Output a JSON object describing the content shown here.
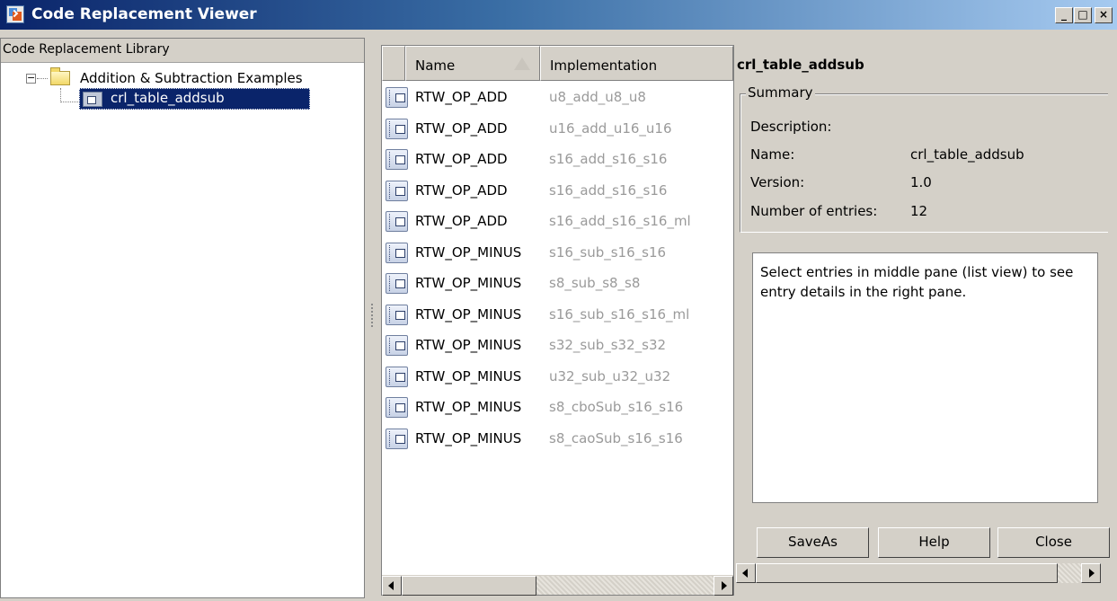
{
  "window": {
    "title": "Code Replacement Viewer",
    "icon": "code-replacement-app-icon"
  },
  "window_controls": {
    "minimize": "_",
    "maximize": "□",
    "close": "×"
  },
  "tree": {
    "header": "Code Replacement Library",
    "folder": {
      "label": "Addition & Subtraction Examples",
      "icon": "folder-icon",
      "expanded": true
    },
    "selected_item": {
      "label": "crl_table_addsub",
      "icon": "table-icon"
    }
  },
  "list": {
    "columns": [
      {
        "label": "Name",
        "sorted": "ascending"
      },
      {
        "label": "Implementation"
      }
    ],
    "rows": [
      {
        "name": "RTW_OP_ADD",
        "implementation": "u8_add_u8_u8"
      },
      {
        "name": "RTW_OP_ADD",
        "implementation": "u16_add_u16_u16"
      },
      {
        "name": "RTW_OP_ADD",
        "implementation": "s16_add_s16_s16"
      },
      {
        "name": "RTW_OP_ADD",
        "implementation": "s16_add_s16_s16"
      },
      {
        "name": "RTW_OP_ADD",
        "implementation": "s16_add_s16_s16_ml"
      },
      {
        "name": "RTW_OP_MINUS",
        "implementation": "s16_sub_s16_s16"
      },
      {
        "name": "RTW_OP_MINUS",
        "implementation": "s8_sub_s8_s8"
      },
      {
        "name": "RTW_OP_MINUS",
        "implementation": "s16_sub_s16_s16_ml"
      },
      {
        "name": "RTW_OP_MINUS",
        "implementation": "s32_sub_s32_s32"
      },
      {
        "name": "RTW_OP_MINUS",
        "implementation": "u32_sub_u32_u32"
      },
      {
        "name": "RTW_OP_MINUS",
        "implementation": "s8_cboSub_s16_s16"
      },
      {
        "name": "RTW_OP_MINUS",
        "implementation": "s8_caoSub_s16_s16"
      }
    ]
  },
  "details": {
    "title": "crl_table_addsub",
    "summary_label": "Summary",
    "fields": [
      {
        "label": "Description:",
        "value": ""
      },
      {
        "label": "Name:",
        "value": "crl_table_addsub"
      },
      {
        "label": "Version:",
        "value": "1.0"
      },
      {
        "label": "Number of entries:",
        "value": "12"
      }
    ],
    "message": "Select entries in middle pane (list view) to see entry details in the right pane.",
    "buttons": {
      "save_as": "SaveAs",
      "help": "Help",
      "close": "Close"
    }
  },
  "colors": {
    "titlebar_start": "#0a246a",
    "selection": "#0a246a",
    "implementation_text": "#9a9a9a",
    "window_face": "#d4d0c8"
  }
}
